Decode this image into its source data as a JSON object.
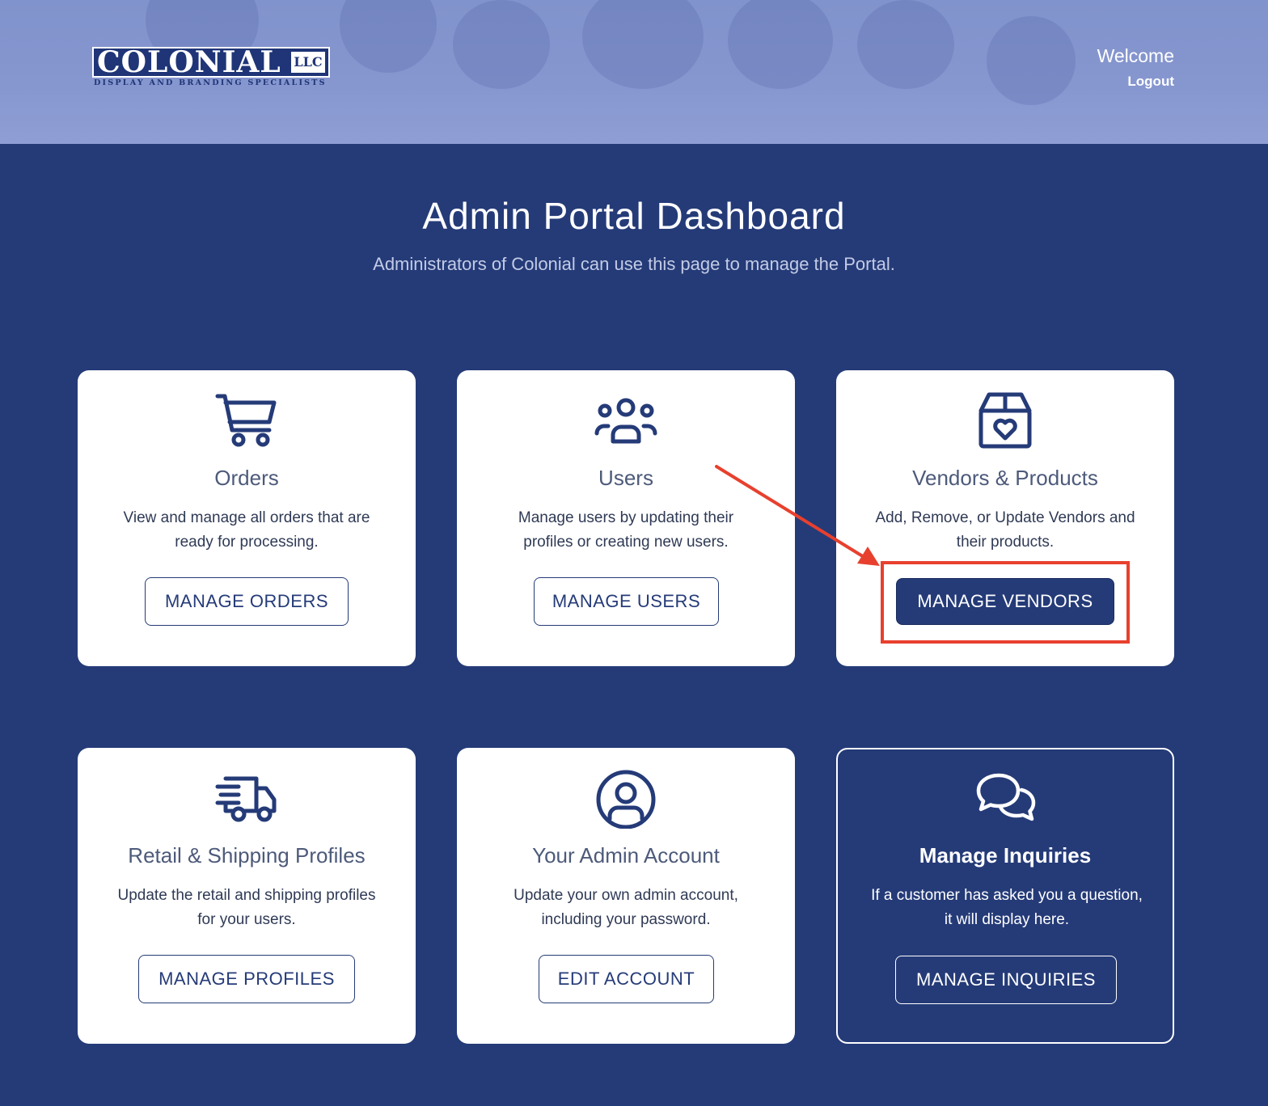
{
  "header": {
    "logo": {
      "word": "COLONIAL",
      "suffix": "LLC",
      "tagline": "DISPLAY AND BRANDING SPECIALISTS"
    },
    "welcome": "Welcome",
    "logout": "Logout"
  },
  "page": {
    "title": "Admin Portal Dashboard",
    "subtitle": "Administrators of Colonial can use this page to manage the Portal."
  },
  "cards": [
    {
      "icon": "shopping-cart-icon",
      "title": "Orders",
      "desc_line1": "View and manage all orders that are",
      "desc_line2": "ready for processing.",
      "button": "MANAGE ORDERS"
    },
    {
      "icon": "users-group-icon",
      "title": "Users",
      "desc_line1": "Manage users by updating their",
      "desc_line2": "profiles or creating new users.",
      "button": "MANAGE USERS"
    },
    {
      "icon": "box-heart-icon",
      "title": "Vendors & Products",
      "desc_line1": "Add, Remove, or Update Vendors and",
      "desc_line2": "their products.",
      "button": "MANAGE VENDORS"
    },
    {
      "icon": "delivery-truck-icon",
      "title": "Retail & Shipping Profiles",
      "desc_line1": "Update the retail and shipping profiles",
      "desc_line2": "for your users.",
      "button": "MANAGE PROFILES"
    },
    {
      "icon": "user-circle-icon",
      "title": "Your Admin Account",
      "desc_line1": "Update your own admin account,",
      "desc_line2": "including your password.",
      "button": "EDIT ACCOUNT"
    },
    {
      "icon": "chat-bubbles-icon",
      "title": "Manage Inquiries",
      "desc_line1": "If a customer has asked you a question,",
      "desc_line2": "it will display here.",
      "button": "MANAGE INQUIRIES"
    }
  ],
  "colors": {
    "background": "#253b78",
    "card": "#ffffff",
    "accent": "#253b78",
    "annotation": "#e8402e"
  }
}
